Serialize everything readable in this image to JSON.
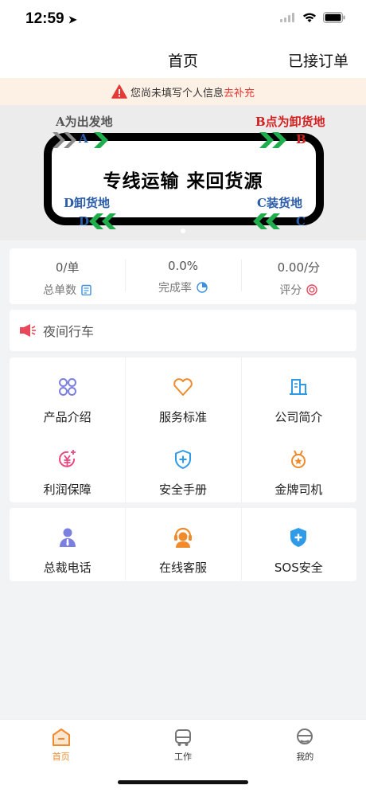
{
  "status_bar": {
    "time": "12:59"
  },
  "nav": {
    "title": "首页",
    "right_label": "已接订单"
  },
  "notice": {
    "text": "您尚未填写个人信息",
    "link": "去补充"
  },
  "banner": {
    "label_a": "A为出发地",
    "letter_a": "A",
    "label_b": "B点为卸货地",
    "letter_b": "B",
    "main_text": "专线运输   来回货源",
    "label_d": "D卸货地",
    "letter_d": "D",
    "label_c": "C装货地",
    "letter_c": "C"
  },
  "stats": [
    {
      "value": "0/单",
      "label": "总单数",
      "icon": "clipboard-icon"
    },
    {
      "value": "0.0%",
      "label": "完成率",
      "icon": "pie-chart-icon"
    },
    {
      "value": "0.00/分",
      "label": "评分",
      "icon": "medal-icon"
    }
  ],
  "announcement": {
    "text": "夜间行车",
    "icon": "megaphone-icon"
  },
  "grid1": [
    {
      "label": "产品介绍",
      "icon": "product-icon"
    },
    {
      "label": "服务标准",
      "icon": "heart-icon"
    },
    {
      "label": "公司简介",
      "icon": "building-icon"
    },
    {
      "label": "利润保障",
      "icon": "yen-coin-icon"
    },
    {
      "label": "安全手册",
      "icon": "shield-plus-icon"
    },
    {
      "label": "金牌司机",
      "icon": "gold-medal-icon"
    }
  ],
  "grid2": [
    {
      "label": "总裁电话",
      "icon": "president-icon"
    },
    {
      "label": "在线客服",
      "icon": "customer-service-icon"
    },
    {
      "label": "SOS安全",
      "icon": "sos-shield-icon"
    }
  ],
  "tabs": [
    {
      "label": "首页",
      "icon": "home-icon",
      "active": true
    },
    {
      "label": "工作",
      "icon": "truck-icon",
      "active": false
    },
    {
      "label": "我的",
      "icon": "profile-icon",
      "active": false
    }
  ],
  "colors": {
    "accent": "#f08a2a",
    "alert": "#e53935",
    "notice_bg": "#fdf0e4"
  }
}
